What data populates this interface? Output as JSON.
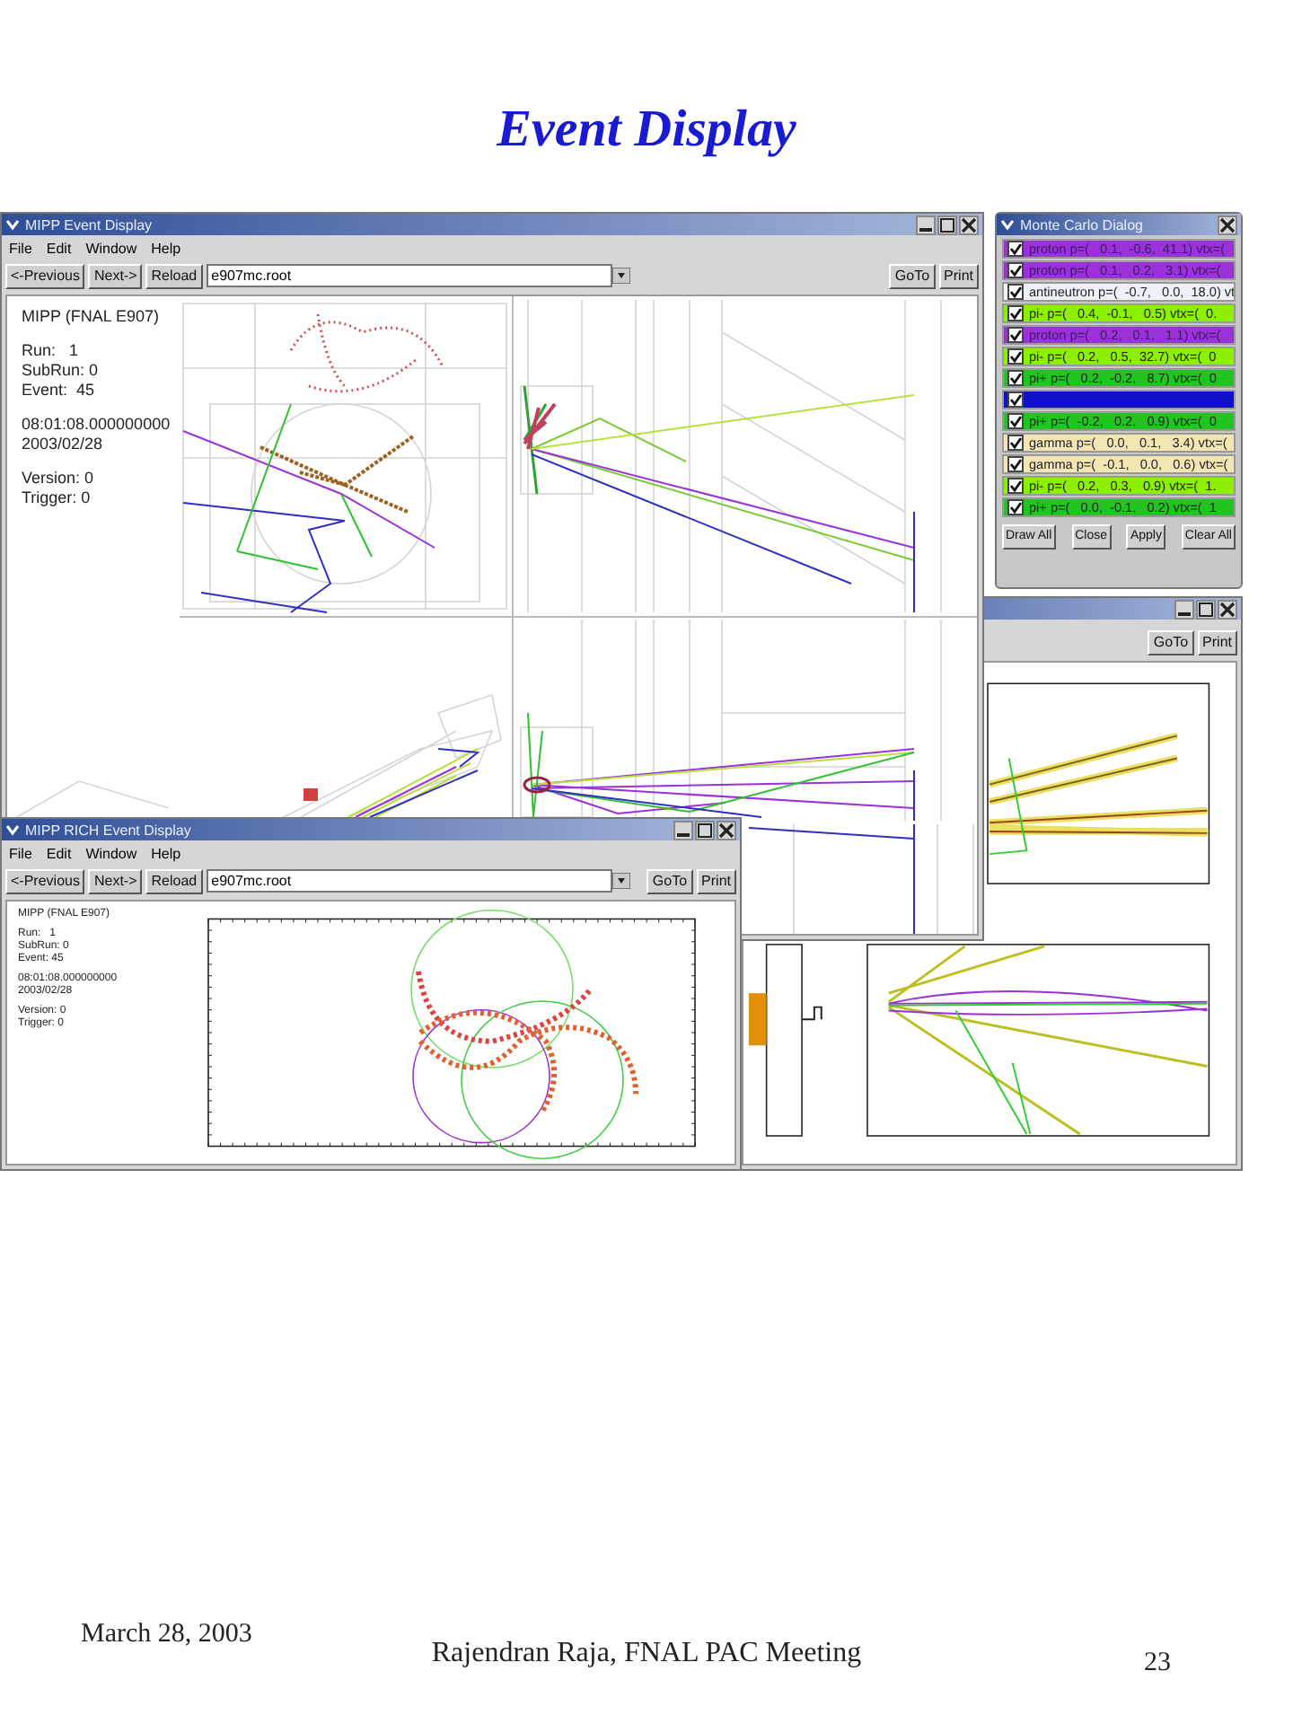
{
  "slide": {
    "title": "Event Display"
  },
  "main_window": {
    "title": "MIPP Event Display",
    "menu": [
      "File",
      "Edit",
      "Window",
      "Help"
    ],
    "buttons": [
      "<-Previous",
      "Next->",
      "Reload"
    ],
    "file_field": {
      "value": "e907mc.root"
    },
    "right_buttons": [
      "GoTo",
      "Print"
    ],
    "info": [
      "MIPP (FNAL E907)",
      "Run:   1",
      "SubRun: 0",
      "Event:  45",
      "08:01:08.000000000",
      "2003/02/28",
      "Version: 0",
      "Trigger: 0"
    ]
  },
  "monte_carlo_dialog": {
    "title": "Monte Carlo Dialog",
    "rows": [
      {
        "label": "proton p=(   0.1,  -0.6,  41.1) vtx=(",
        "checked": true,
        "color": "#9a32d8"
      },
      {
        "label": "proton p=(   0.1,   0.2,   3.1) vtx=(",
        "checked": true,
        "color": "#9a32d8"
      },
      {
        "label": "antineutron p=(  -0.7,   0.0,  18.0) vt",
        "checked": true,
        "color": "#eef0fa"
      },
      {
        "label": "pi- p=(   0.4,  -0.1,   0.5) vtx=(  0.",
        "checked": true,
        "color": "#8cf000"
      },
      {
        "label": "proton p=(   0.2,   0.1,   1.1) vtx=(",
        "checked": true,
        "color": "#9a32d8"
      },
      {
        "label": "pi- p=(   0.2,   0.5,  32.7) vtx=(  0",
        "checked": true,
        "color": "#8cf000"
      },
      {
        "label": "pi+ p=(   0.2,  -0.2,   8.7) vtx=(  0",
        "checked": true,
        "color": "#22c422"
      },
      {
        "checked": true,
        "color": "#1010c8"
      },
      {
        "label": "pi+ p=(  -0.2,   0.2,   0.9) vtx=(  0",
        "checked": true,
        "color": "#22c422"
      },
      {
        "label": "gamma p=(   0.0,   0.1,   3.4) vtx=(",
        "checked": true,
        "color": "#f4e6b4"
      },
      {
        "label": "gamma p=(  -0.1,   0.0,   0.6) vtx=(",
        "checked": true,
        "color": "#f4e6b4"
      },
      {
        "label": "pi- p=(   0.2,   0.3,   0.9) vtx=(  1.",
        "checked": true,
        "color": "#8cf000"
      },
      {
        "label": "pi+ p=(   0.0,  -0.1,   0.2) vtx=(  1",
        "checked": true,
        "color": "#22c422"
      }
    ],
    "buttons": [
      "Draw All",
      "Close",
      "Apply",
      "Clear All"
    ]
  },
  "plot_window": {
    "right_buttons": [
      "GoTo",
      "Print"
    ]
  },
  "rich_window": {
    "title": "MIPP RICH Event Display",
    "menu": [
      "File",
      "Edit",
      "Window",
      "Help"
    ],
    "buttons": [
      "<-Previous",
      "Next->",
      "Reload"
    ],
    "file_field": {
      "value": "e907mc.root"
    },
    "right_buttons": [
      "GoTo",
      "Print"
    ],
    "info": [
      "MIPP (FNAL E907)",
      "Run:   1",
      "SubRun: 0",
      "Event: 45",
      "08:01:08.000000000",
      "2003/02/28",
      "Version: 0",
      "Trigger: 0"
    ]
  },
  "footer": {
    "date": "March 28, 2003",
    "author": "Rajendran Raja, FNAL PAC Meeting",
    "page": "23"
  }
}
